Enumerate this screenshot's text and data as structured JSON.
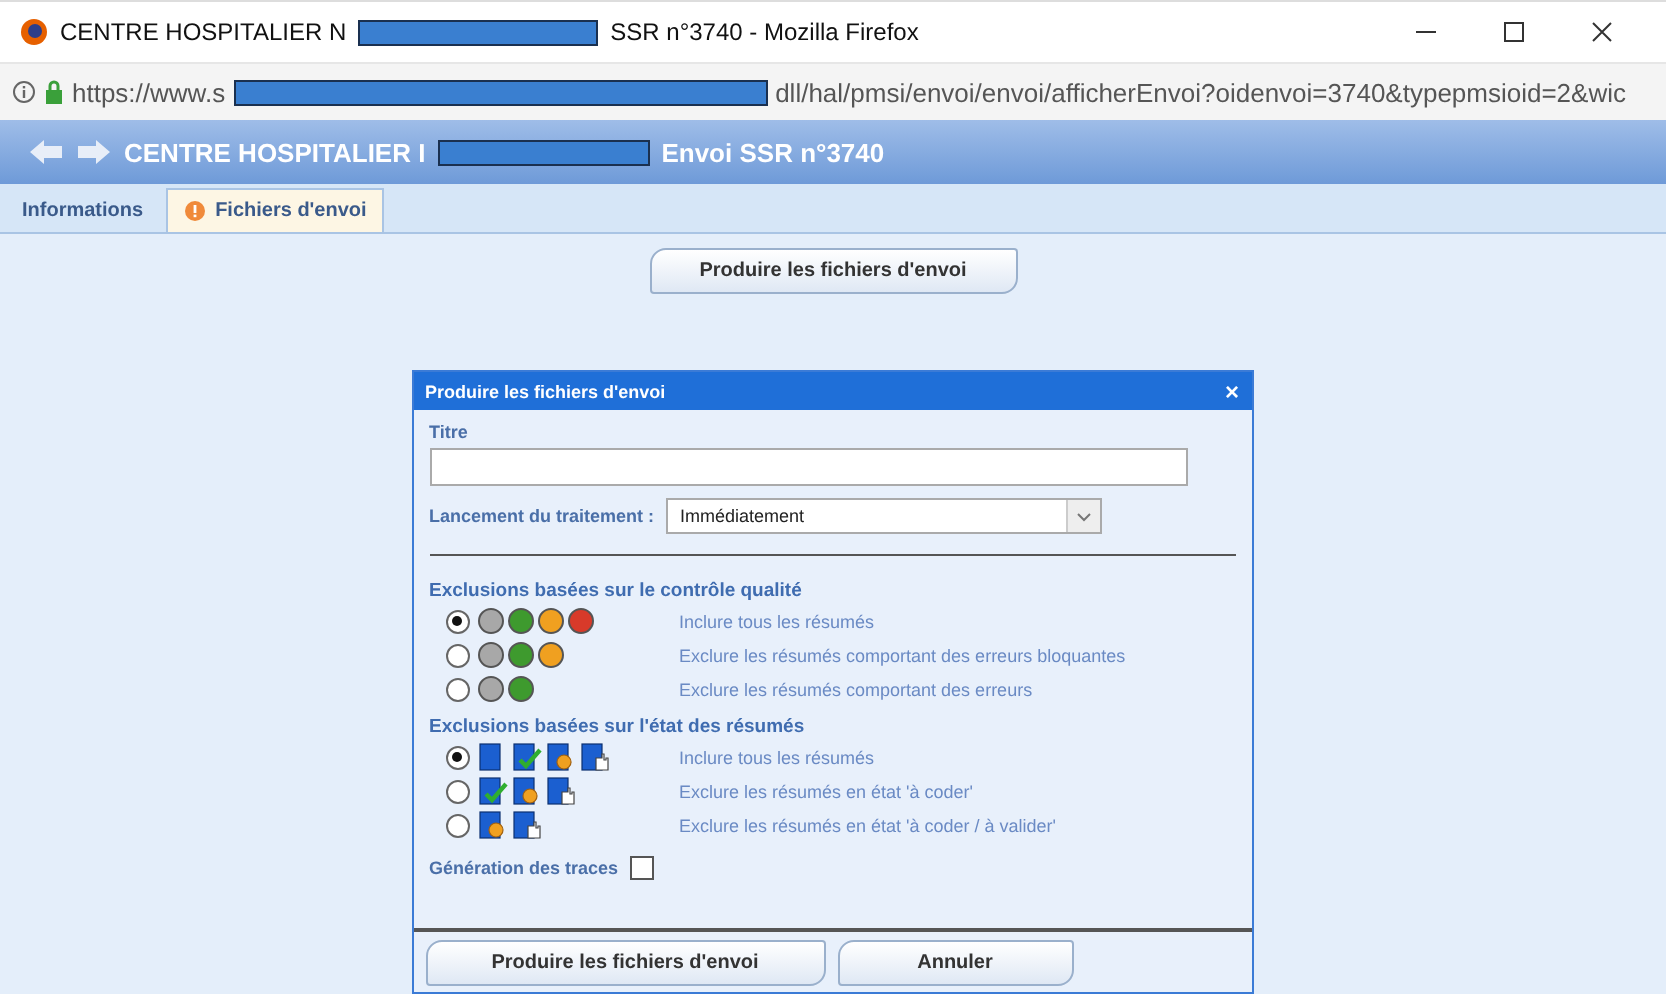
{
  "window": {
    "title_before": "CENTRE HOSPITALIER N",
    "title_after": "SSR n°3740 - Mozilla Firefox"
  },
  "address_bar": {
    "url_before": "https://www.s",
    "url_after": "dll/hal/pmsi/envoi/envoi/afficherEnvoi?oidenvoi=3740&typepmsioid=2&wic"
  },
  "header": {
    "title_before": "CENTRE HOSPITALIER I",
    "title_after": "Envoi SSR n°3740"
  },
  "tabs": [
    {
      "label": "Informations",
      "selected": false,
      "warning": false
    },
    {
      "label": "Fichiers d'envoi",
      "selected": true,
      "warning": true
    }
  ],
  "produce_button": "Produire les fichiers d'envoi",
  "dialog": {
    "title": "Produire les fichiers d'envoi",
    "close": "×",
    "titre_label": "Titre",
    "launch_label": "Lancement du traitement :",
    "launch_value": "Immédiatement",
    "quality_heading": "Exclusions basées sur le contrôle qualité",
    "quality_options": [
      {
        "selected": true,
        "label": "Inclure tous les résumés",
        "dots": [
          {
            "color": "#a8a8a8"
          },
          {
            "color": "#3e9a2e"
          },
          {
            "color": "#f0a020"
          },
          {
            "color": "#d83a2a"
          }
        ]
      },
      {
        "selected": false,
        "label": "Exclure les résumés comportant des erreurs bloquantes",
        "dots": [
          {
            "color": "#a8a8a8"
          },
          {
            "color": "#3e9a2e"
          },
          {
            "color": "#f0a020"
          }
        ]
      },
      {
        "selected": false,
        "label": "Exclure les résumés comportant des erreurs",
        "dots": [
          {
            "color": "#a8a8a8"
          },
          {
            "color": "#3e9a2e"
          }
        ]
      }
    ],
    "state_heading": "Exclusions basées sur l'état des résumés",
    "state_options": [
      {
        "selected": true,
        "label": "Inclure tous les résumés",
        "icons": [
          {
            "kind": "plain"
          },
          {
            "kind": "check"
          },
          {
            "kind": "gear"
          },
          {
            "kind": "hand"
          }
        ]
      },
      {
        "selected": false,
        "label": "Exclure les résumés en état 'à coder'",
        "icons": [
          {
            "kind": "check"
          },
          {
            "kind": "gear"
          },
          {
            "kind": "hand"
          }
        ]
      },
      {
        "selected": false,
        "label": "Exclure les résumés en état 'à coder / à valider'",
        "icons": [
          {
            "kind": "gear"
          },
          {
            "kind": "hand"
          }
        ]
      }
    ],
    "traces_label": "Génération des traces",
    "traces_checked": false,
    "buttons": [
      "Produire les fichiers d'envoi",
      "Annuler"
    ]
  }
}
